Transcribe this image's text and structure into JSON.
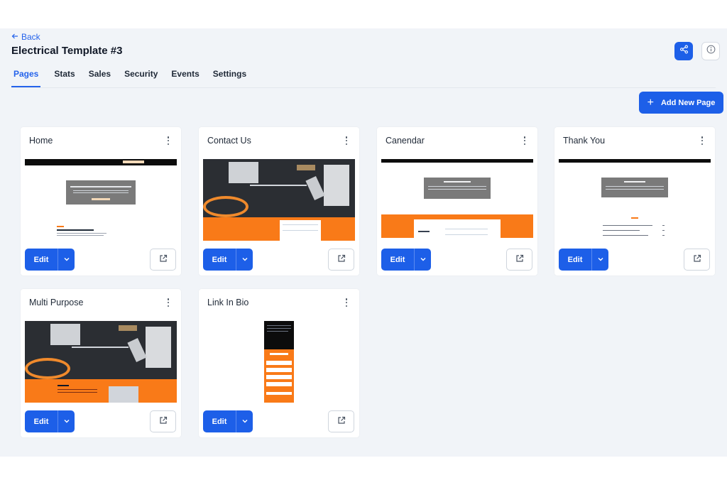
{
  "header": {
    "back_label": "Back",
    "title": "Electrical Template #3"
  },
  "tabs": [
    {
      "label": "Pages",
      "active": true
    },
    {
      "label": "Stats"
    },
    {
      "label": "Sales"
    },
    {
      "label": "Security"
    },
    {
      "label": "Events"
    },
    {
      "label": "Settings"
    }
  ],
  "actions": {
    "add_page_label": "Add New Page"
  },
  "cards": [
    {
      "title": "Home",
      "edit_label": "Edit"
    },
    {
      "title": "Contact Us",
      "edit_label": "Edit"
    },
    {
      "title": "Canendar",
      "edit_label": "Edit"
    },
    {
      "title": "Thank You",
      "edit_label": "Edit"
    },
    {
      "title": "Multi Purpose",
      "edit_label": "Edit"
    },
    {
      "title": "Link In Bio",
      "edit_label": "Edit"
    }
  ],
  "colors": {
    "primary": "#1d5fe8",
    "accent_orange": "#f97a18",
    "background": "#f1f4f8"
  }
}
